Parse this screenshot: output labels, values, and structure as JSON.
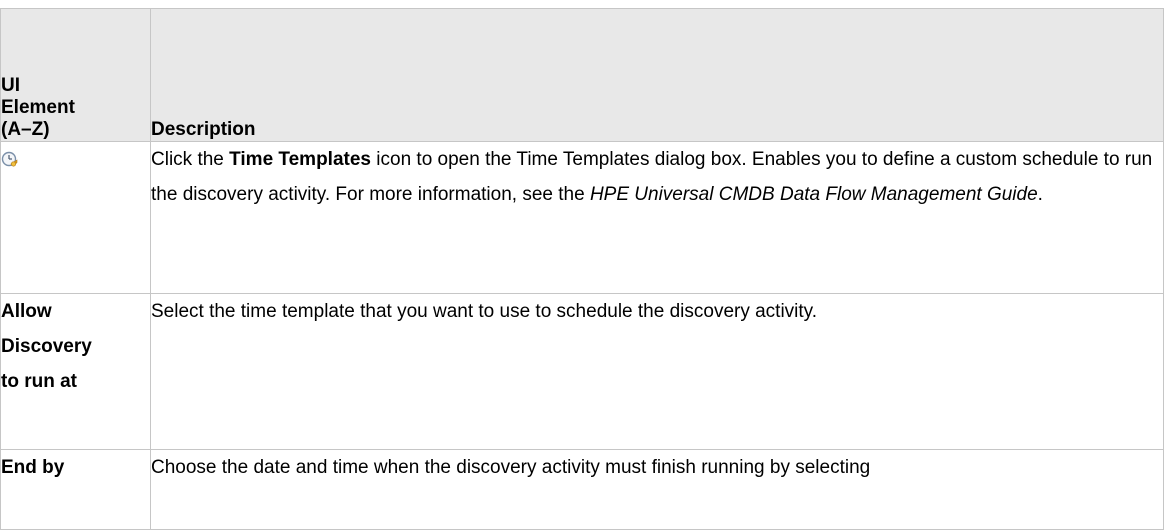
{
  "table": {
    "headers": {
      "ui_element": [
        "UI",
        "Element",
        "(A–Z)"
      ],
      "description": "Description"
    },
    "rows": [
      {
        "ui_element_icon": "time-templates-icon",
        "description": {
          "pre": "Click the ",
          "bold": "Time Templates",
          "mid": " icon to open the Time Templates dialog box. Enables you to define a custom schedule to run the discovery activity. For more information, see the ",
          "italic": "HPE Universal CMDB Data Flow Management Guide",
          "post": "."
        }
      },
      {
        "ui_element": [
          "Allow",
          "Discovery",
          "to run at"
        ],
        "description": "Select the time template that you want to use to schedule the discovery activity."
      },
      {
        "ui_element": [
          "End by"
        ],
        "description": "Choose the date and time when the discovery activity must finish running by selecting"
      }
    ]
  },
  "colors": {
    "header_bg": "#e8e8e8",
    "border": "#c6c6c6",
    "icon_clock": "#7a8fa8",
    "icon_arrow": "#e0a020"
  }
}
